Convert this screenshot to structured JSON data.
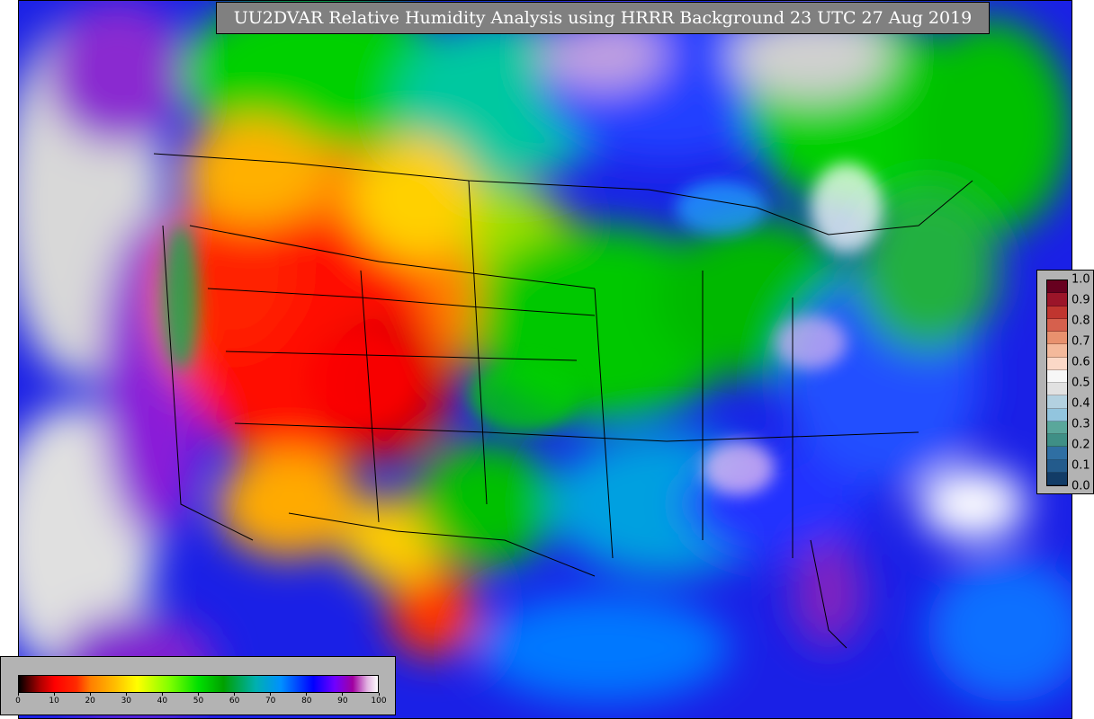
{
  "title": "UU2DVAR Relative Humidity Analysis using HRRR Background 23 UTC 27 Aug 2019",
  "rh_colorbar": {
    "ticks": [
      "0",
      "10",
      "20",
      "30",
      "40",
      "50",
      "60",
      "70",
      "80",
      "90",
      "100"
    ],
    "range": [
      0,
      100
    ],
    "stops": [
      {
        "v": 0,
        "c": "#000000"
      },
      {
        "v": 3,
        "c": "#5a0000"
      },
      {
        "v": 6,
        "c": "#b00000"
      },
      {
        "v": 10,
        "c": "#ff0000"
      },
      {
        "v": 16,
        "c": "#ff2a00"
      },
      {
        "v": 20,
        "c": "#ff7f00"
      },
      {
        "v": 27,
        "c": "#ffbf00"
      },
      {
        "v": 33,
        "c": "#ffff00"
      },
      {
        "v": 42,
        "c": "#7fff00"
      },
      {
        "v": 50,
        "c": "#00e000"
      },
      {
        "v": 57,
        "c": "#00a000"
      },
      {
        "v": 66,
        "c": "#00b0b0"
      },
      {
        "v": 73,
        "c": "#0090ff"
      },
      {
        "v": 82,
        "c": "#0000ff"
      },
      {
        "v": 88,
        "c": "#7000ff"
      },
      {
        "v": 93,
        "c": "#a000a0"
      },
      {
        "v": 97,
        "c": "#e0b0e0"
      },
      {
        "v": 100,
        "c": "#ffffff"
      }
    ]
  },
  "ratio_colorbar": {
    "ticks": [
      "1.0",
      "0.9",
      "0.8",
      "0.7",
      "0.6",
      "0.5",
      "0.4",
      "0.3",
      "0.2",
      "0.1",
      "0.0"
    ],
    "range": [
      0.0,
      1.0
    ],
    "colors_top_to_bottom": [
      "#67001f",
      "#9b1529",
      "#c0352f",
      "#d6604d",
      "#e8916e",
      "#f4b99b",
      "#fbd8c7",
      "#f7f7f7",
      "#e1e1e1",
      "#b3d1e0",
      "#92c5de",
      "#5aa79b",
      "#3f8f86",
      "#2f6fa3",
      "#235b8c",
      "#123c67"
    ]
  },
  "colors": {
    "land_mask": "#d0d0d0",
    "borders": "#000000",
    "title_bg": "#808080"
  }
}
